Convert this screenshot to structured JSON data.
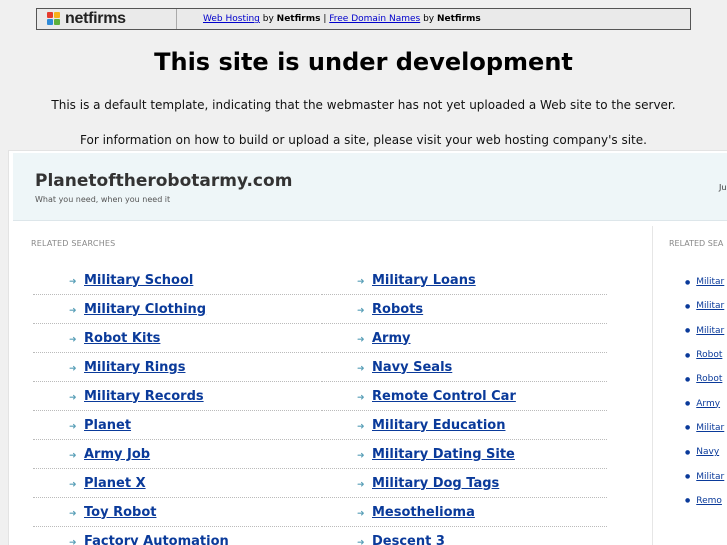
{
  "banner": {
    "logo_text": "netfirms",
    "link1": "Web Hosting",
    "by1": " by ",
    "brand1": "Netfirms",
    "sep": " | ",
    "link2": "Free Domain Names",
    "by2": " by ",
    "brand2": "Netfirms"
  },
  "heading": "This site is under development",
  "description1": "This is a default template, indicating that the webmaster has not yet uploaded a Web site to the server.",
  "description2": "For information on how to build or upload a site, please visit your web hosting company's site.",
  "site": {
    "title": "Planetoftherobotarmy.com",
    "tagline": "What you need, when you need it",
    "header_right": "Ju"
  },
  "related": {
    "label": "RELATED SEARCHES",
    "left": [
      "Military School",
      "Military Clothing",
      "Robot Kits",
      "Military Rings",
      "Military Records",
      "Planet",
      "Army Job",
      "Planet X",
      "Toy Robot",
      "Factory Automation"
    ],
    "right": [
      "Military Loans",
      "Robots",
      "Army",
      "Navy Seals",
      "Remote Control Car",
      "Military Education",
      "Military Dating Site",
      "Military Dog Tags",
      "Mesothelioma",
      "Descent 3"
    ]
  },
  "sidebar": {
    "label": "RELATED SEA",
    "items": [
      "Militar",
      "Militar",
      "Militar",
      "Robot",
      "Robot",
      "Army",
      "Militar",
      "Navy",
      "Militar",
      "Remo"
    ]
  },
  "colors": {
    "link": "#0a3a9a",
    "arrow": "#5aa0b8",
    "header_bg": "#eef6f8"
  },
  "icons": {
    "bullet": "arrow-right-icon",
    "side_bullet": "dot-icon"
  }
}
